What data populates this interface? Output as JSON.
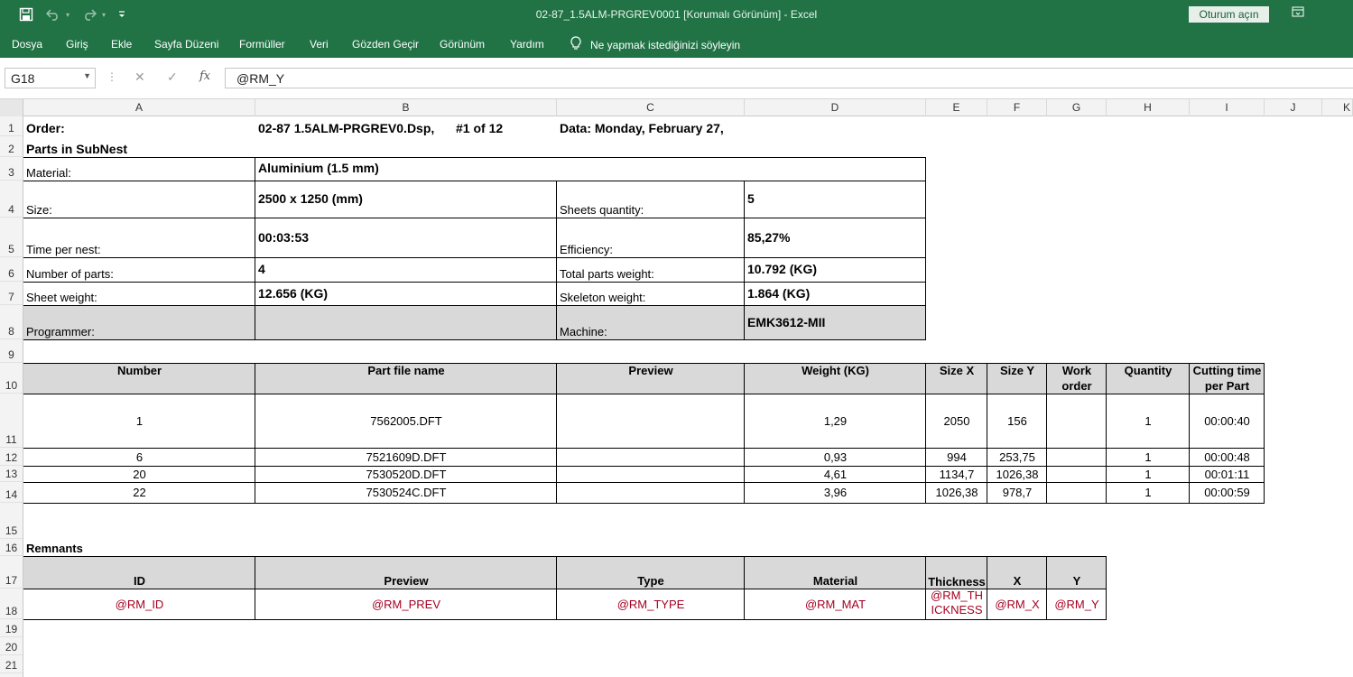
{
  "titlebar": {
    "title": "02-87_1.5ALM-PRGREV0001  [Korumalı Görünüm]  -  Excel",
    "signin": "Oturum açın",
    "icons": [
      "save-icon",
      "undo-icon",
      "redo-icon",
      "customize-icon",
      "restore-icon"
    ]
  },
  "ribbon": {
    "tabs": [
      "Dosya",
      "Giriş",
      "Ekle",
      "Sayfa Düzeni",
      "Formüller",
      "Veri",
      "Gözden Geçir",
      "Görünüm",
      "Yardım"
    ],
    "tell_me": "Ne yapmak istediğinizi söyleyin"
  },
  "formula_bar": {
    "name_box": "G18",
    "fx": "fx",
    "value": "@RM_Y"
  },
  "columns": [
    "A",
    "B",
    "C",
    "D",
    "E",
    "F",
    "G",
    "H",
    "I",
    "J",
    "K"
  ],
  "rows": [
    "1",
    "2",
    "3",
    "4",
    "5",
    "6",
    "7",
    "8",
    "9",
    "10",
    "11",
    "12",
    "13",
    "14",
    "15",
    "16",
    "17",
    "18",
    "19",
    "20",
    "21"
  ],
  "header": {
    "order_label": "Order:",
    "order_value": "02-87 1.5ALM-PRGREV0.Dsp,",
    "sheet_count": "#1 of 12",
    "date": "Data: Monday, February 27,",
    "parts_title": "Parts in SubNest"
  },
  "info": {
    "material_label": "Material:",
    "material_value": "Aluminium (1.5 mm)",
    "size_label": "Size:",
    "size_value": "2500 x 1250 (mm)",
    "sheets_qty_label": "Sheets quantity:",
    "sheets_qty_value": "5",
    "time_label": "Time per nest:",
    "time_value": "00:03:53",
    "efficiency_label": "Efficiency:",
    "efficiency_value": "85,27%",
    "num_parts_label": "Number of parts:",
    "num_parts_value": "4",
    "total_weight_label": "Total parts weight:",
    "total_weight_value": "10.792 (KG)",
    "sheet_weight_label": "Sheet weight:",
    "sheet_weight_value": "12.656 (KG)",
    "skeleton_label": "Skeleton weight:",
    "skeleton_value": "1.864 (KG)",
    "programmer_label": "Programmer:",
    "programmer_value": "",
    "machine_label": "Machine:",
    "machine_value": "EMK3612-MII"
  },
  "parts_table": {
    "headers": [
      "Number",
      "Part file name",
      "Preview",
      "Weight (KG)",
      "Size X",
      "Size Y",
      "Work order",
      "Quantity",
      "Cutting time per Part"
    ],
    "rows": [
      [
        "1",
        "7562005.DFT",
        "",
        "1,29",
        "2050",
        "156",
        "",
        "1",
        "00:00:40"
      ],
      [
        "6",
        "7521609D.DFT",
        "",
        "0,93",
        "994",
        "253,75",
        "",
        "1",
        "00:00:48"
      ],
      [
        "20",
        "7530520D.DFT",
        "",
        "4,61",
        "1134,7",
        "1026,38",
        "",
        "1",
        "00:01:11"
      ],
      [
        "22",
        "7530524C.DFT",
        "",
        "3,96",
        "1026,38",
        "978,7",
        "",
        "1",
        "00:00:59"
      ]
    ]
  },
  "remnants": {
    "title": "Remnants",
    "headers": [
      "ID",
      "Preview",
      "Type",
      "Material",
      "Thickness",
      "X",
      "Y"
    ],
    "row": [
      "@RM_ID",
      "@RM_PREV",
      "@RM_TYPE",
      "@RM_MAT",
      "@RM_THICKNESS",
      "@RM_X",
      "@RM_Y"
    ]
  }
}
